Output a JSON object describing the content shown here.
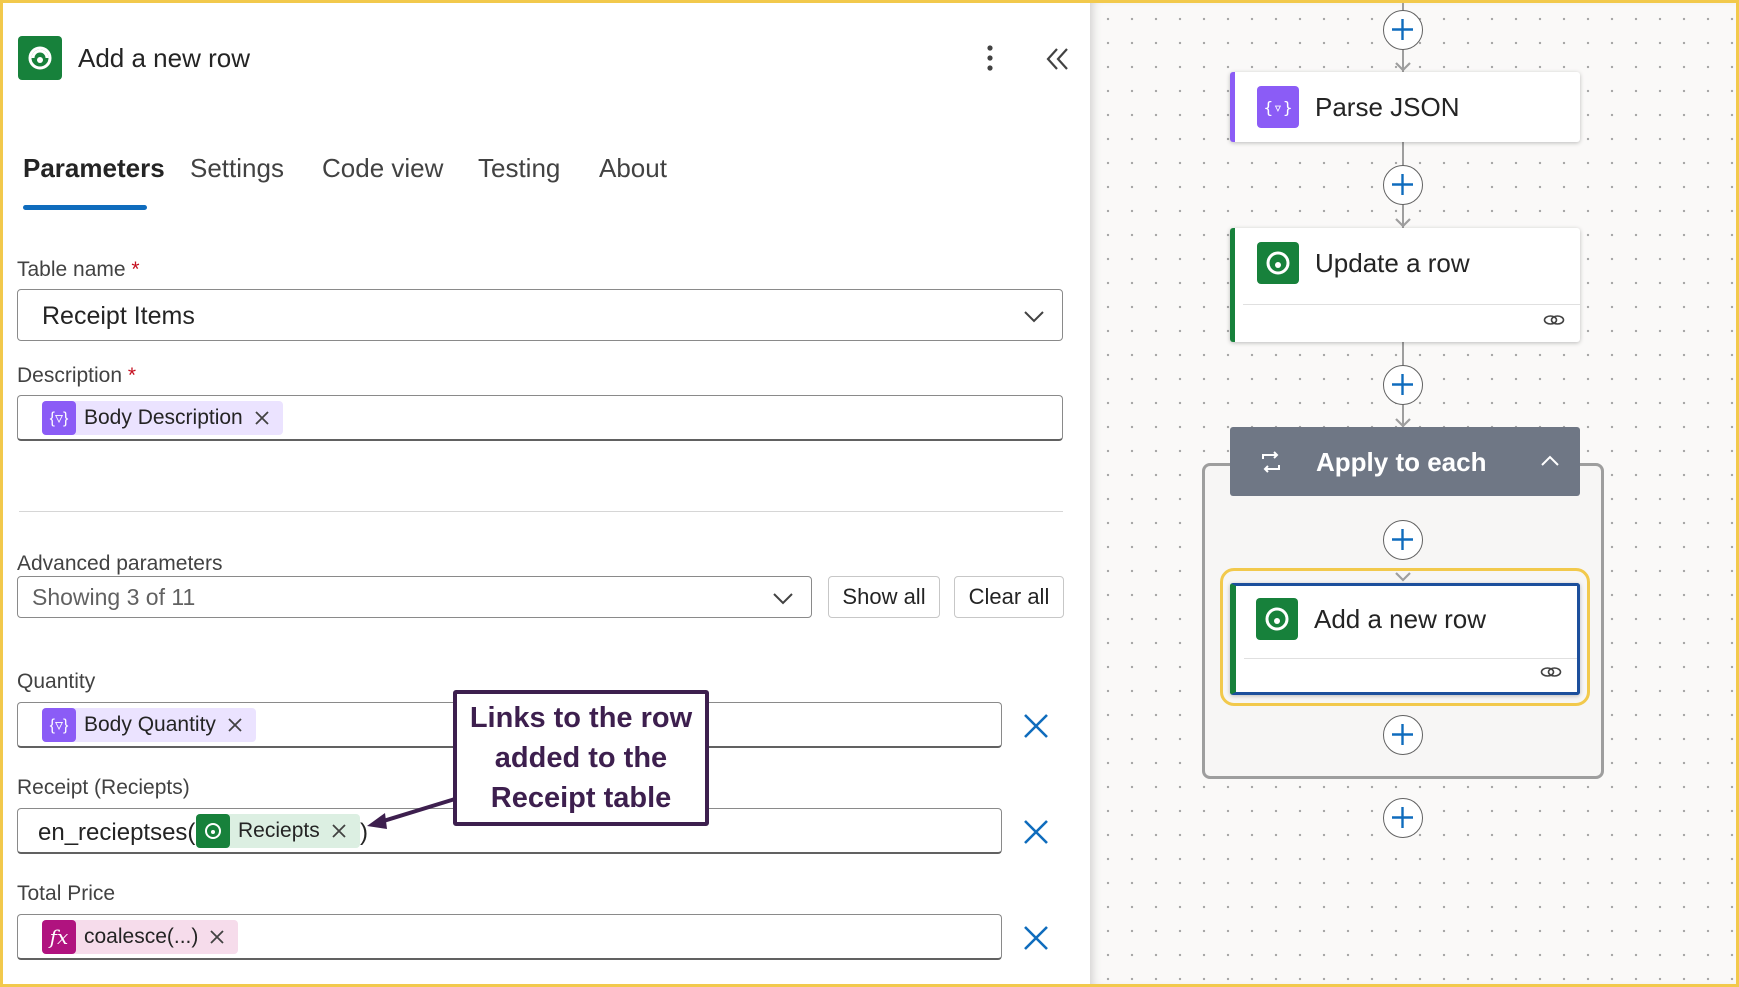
{
  "panel": {
    "title": "Add a new row",
    "tabs": [
      "Parameters",
      "Settings",
      "Code view",
      "Testing",
      "About"
    ],
    "active_tab": "Parameters"
  },
  "fields": {
    "table_name": {
      "label": "Table name",
      "required_mark": "*",
      "value": "Receipt Items"
    },
    "description": {
      "label": "Description",
      "required_mark": "*",
      "token": "Body Description"
    },
    "advanced": {
      "label": "Advanced parameters",
      "value": "Showing 3 of 11",
      "show_all": "Show all",
      "clear_all": "Clear all"
    },
    "quantity": {
      "label": "Quantity",
      "token": "Body Quantity"
    },
    "receipt": {
      "label": "Receipt (Reciepts)",
      "prefix": "en_recieptses(",
      "token": "Reciepts",
      "suffix": ")"
    },
    "total_price": {
      "label": "Total Price",
      "token": "coalesce(...)"
    }
  },
  "callout": {
    "line1": "Links to the row",
    "line2": "added to the",
    "line3": "Receipt table"
  },
  "flow": {
    "parse_json": "Parse JSON",
    "update_row": "Update a row",
    "apply_each": "Apply to each",
    "add_row": "Add a new row"
  },
  "colors": {
    "dataverse_green": "#17813b",
    "parse_purple": "#8b5cf6",
    "accent_blue": "#0f6cbd",
    "callout_border": "#3d1f4e",
    "highlight_yellow": "#f2c94c"
  },
  "icons": {
    "dataverse": "dataverse-icon",
    "parse": "parse-json-icon",
    "expression": "fx-icon",
    "loop": "loop-icon",
    "link": "link-icon"
  }
}
